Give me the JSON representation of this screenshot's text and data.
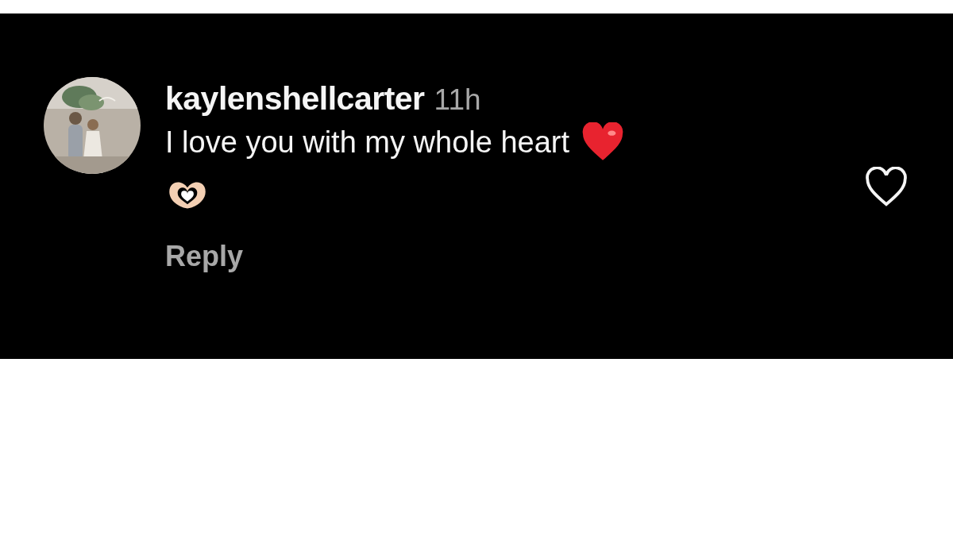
{
  "comment": {
    "username": "kaylenshellcarter",
    "time": "11h",
    "text": "I love you with my whole heart",
    "liked": false,
    "reply": "Reply"
  }
}
